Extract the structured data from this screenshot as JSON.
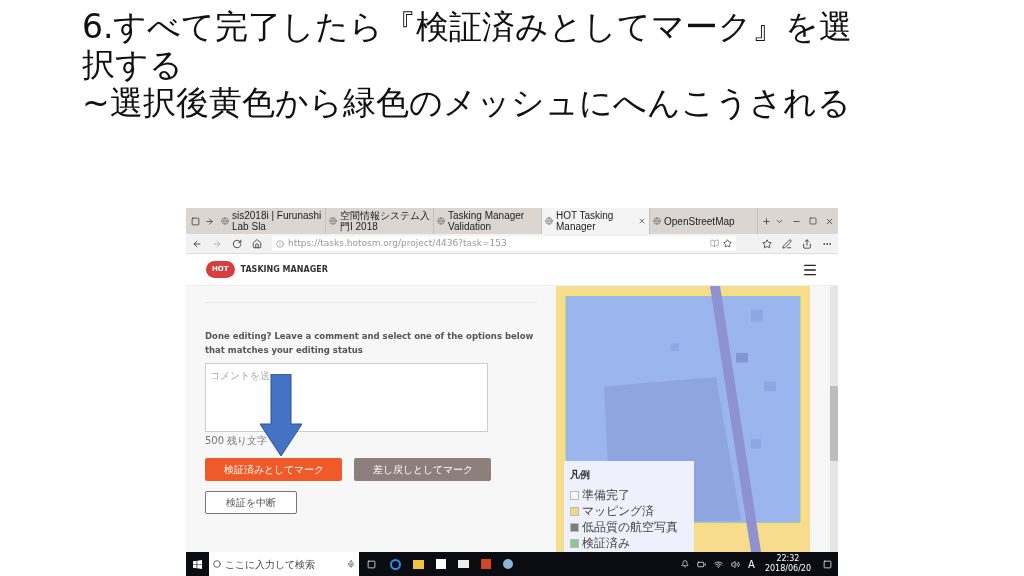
{
  "slide": {
    "title": "6.すべて完了したら『検証済みとしてマーク』を選択する",
    "subtitle": "~選択後黄色から緑色のメッシュにへんこうされる"
  },
  "browser": {
    "tabs": [
      {
        "label": "sis2018i | Furunashi Lab Sla",
        "selected": false
      },
      {
        "label": "空間情報システム入門I 2018",
        "selected": false
      },
      {
        "label": "Tasking Manager Validation",
        "selected": false
      },
      {
        "label": "HOT Tasking Manager",
        "selected": true
      },
      {
        "label": "OpenStreetMap",
        "selected": false
      }
    ],
    "address": "https://tasks.hotosm.org/project/4436?task=153",
    "logo": "HOT",
    "app_title": "TASKING MANAGER"
  },
  "panel": {
    "prompt": "Done editing? Leave a comment and select one of the options below that matches your editing status",
    "comment_placeholder": "コメントを送",
    "counter": "500 残り文字",
    "buttons": [
      {
        "label": "検証済みとしてマーク",
        "kind": "primary"
      },
      {
        "label": "差し戻しとしてマーク",
        "kind": "secondary"
      },
      {
        "label": "検証を中断",
        "kind": "outline"
      }
    ]
  },
  "legend": {
    "title": "凡例",
    "items": [
      {
        "label": "準備完了",
        "color": "#f4f6fb"
      },
      {
        "label": "マッピング済",
        "color": "#f2d77e"
      },
      {
        "label": "低品質の航空写真",
        "color": "#7d7d7d"
      },
      {
        "label": "検証済み",
        "color": "#86c98a"
      }
    ]
  },
  "taskbar": {
    "search_placeholder": "ここに入力して検索",
    "ime": "A",
    "time": "22:32",
    "date": "2018/06/20"
  }
}
